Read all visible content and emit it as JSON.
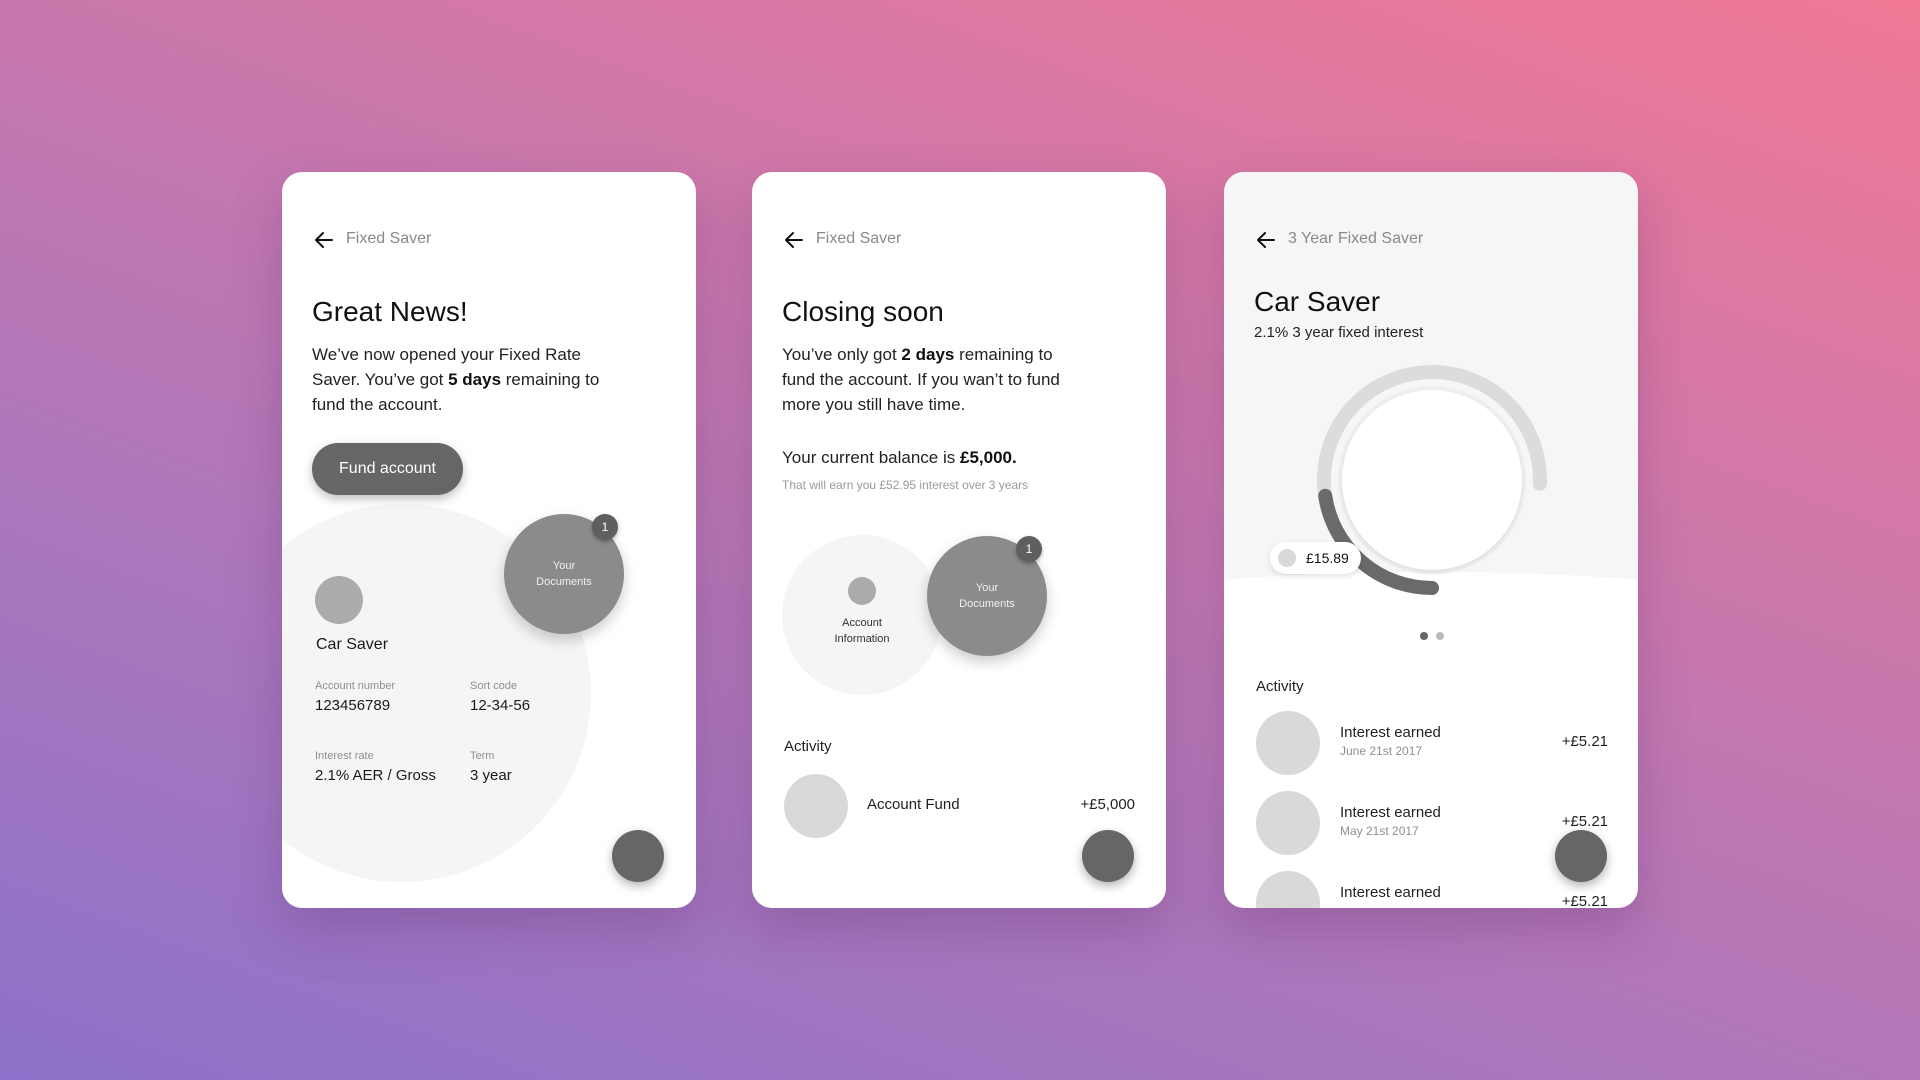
{
  "colors": {
    "background_start": "#8c72ca",
    "background_end": "#f07894",
    "button": "#666666",
    "doc_circle": "#8b8b8b",
    "badge": "#5f5f5f",
    "gauge_track": "#dcdcdc",
    "gauge_progress": "#6a6a6a"
  },
  "screens": [
    {
      "nav_title": "Fixed Saver",
      "heading": "Great News!",
      "body": {
        "pre": "We’ve now opened your Fixed Rate Saver. You’ve got ",
        "bold": "5 days",
        "post": " remaining to fund the account."
      },
      "fund_button": "Fund account",
      "documents": {
        "label_line1": "Your",
        "label_line2": "Documents",
        "badge_count": "1"
      },
      "account": {
        "name": "Car Saver",
        "fields": [
          {
            "label": "Account number",
            "value": "123456789"
          },
          {
            "label": "Sort code",
            "value": "12-34-56"
          },
          {
            "label": "Interest rate",
            "value": "2.1% AER / Gross"
          },
          {
            "label": "Term",
            "value": "3 year"
          }
        ]
      }
    },
    {
      "nav_title": "Fixed Saver",
      "heading": "Closing soon",
      "body": {
        "pre": "You’ve only got ",
        "bold": "2 days",
        "post": " remaining to fund the account. If you wan’t to fund more you still have time."
      },
      "balance": {
        "pre": "Your current balance is ",
        "bold": "£5,000."
      },
      "interest_note": "That will earn you £52.95 interest over 3 years",
      "account_info": {
        "line1": "Account",
        "line2": "Information"
      },
      "documents": {
        "label_line1": "Your",
        "label_line2": "Documents",
        "badge_count": "1"
      },
      "activity_label": "Activity",
      "activity": [
        {
          "title": "Account Fund",
          "amount": "+£5,000"
        }
      ]
    },
    {
      "nav_title": "3 Year Fixed Saver",
      "heading": "Car Saver",
      "subtitle": "2.1% 3 year fixed interest",
      "gauge": {
        "label": "£15.89",
        "progress_fraction": 0.3
      },
      "pager": {
        "count": 2,
        "active": 0
      },
      "activity_label": "Activity",
      "activity": [
        {
          "title": "Interest earned",
          "date": "June 21st 2017",
          "amount": "+£5.21"
        },
        {
          "title": "Interest earned",
          "date": "May 21st 2017",
          "amount": "+£5.21"
        },
        {
          "title": "Interest earned",
          "date": "",
          "amount": "+£5.21"
        }
      ]
    }
  ]
}
